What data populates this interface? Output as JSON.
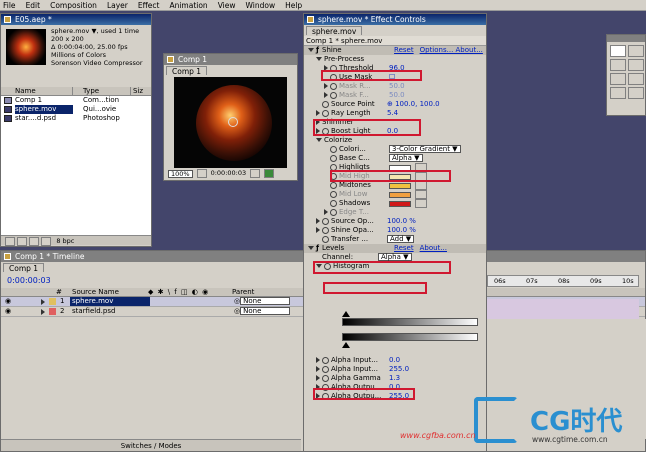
{
  "menu": [
    "File",
    "Edit",
    "Composition",
    "Layer",
    "Effect",
    "Animation",
    "View",
    "Window",
    "Help"
  ],
  "project": {
    "title": "E05.aep *",
    "info_lines": [
      "sphere.mov ▼, used 1 time",
      "200 x 200",
      "Δ 0:00:04:00, 25.00 fps",
      "Millions of Colors",
      "Sorenson Video Compressor"
    ],
    "col_name": "Name",
    "col_type": "Type",
    "col_size": "Siz",
    "items": [
      {
        "name": "Comp 1",
        "type": "Com...tion",
        "selected": false
      },
      {
        "name": "sphere.mov",
        "type": "Qui...ovie",
        "selected": true
      },
      {
        "name": "star....d.psd",
        "type": "Photoshop",
        "selected": false
      }
    ],
    "bpc": "8 bpc"
  },
  "comp": {
    "title": "Comp 1",
    "tab": "Comp 1",
    "zoom": "100%",
    "time": "0:00:00:03"
  },
  "effects": {
    "title": "sphere.mov * Effect Controls",
    "tab": "sphere.mov",
    "breadcrumb": "Comp 1 * sphere.mov",
    "rows": [
      {
        "indent": 0,
        "twirl": "down",
        "fx": true,
        "label": "Shine",
        "value": "Reset",
        "extra": "Options...   About..."
      },
      {
        "indent": 1,
        "twirl": "down",
        "label": "Pre-Process",
        "value": "",
        "extra": ""
      },
      {
        "indent": 2,
        "twirl": "right",
        "stop": true,
        "label": "Threshold",
        "value": "96.0",
        "extra": ""
      },
      {
        "indent": 2,
        "twirl": "none",
        "stop": true,
        "label": "Use Mask",
        "value": "☐",
        "extra": ""
      },
      {
        "indent": 2,
        "twirl": "right",
        "stop": true,
        "label": "Mask R...",
        "value": "50.0",
        "extra": "",
        "dim": true
      },
      {
        "indent": 2,
        "twirl": "right",
        "stop": true,
        "label": "Mask F...",
        "value": "50.0",
        "extra": "",
        "dim": true
      },
      {
        "indent": 1,
        "twirl": "none",
        "stop": true,
        "label": "Source Point",
        "value": "⊕  100.0, 100.0",
        "extra": ""
      },
      {
        "indent": 1,
        "twirl": "right",
        "stop": true,
        "label": "Ray Length",
        "value": "5.4",
        "extra": ""
      },
      {
        "indent": 1,
        "twirl": "right",
        "label": "Shimmer",
        "value": "",
        "extra": ""
      },
      {
        "indent": 1,
        "twirl": "right",
        "stop": true,
        "label": "Boost Light",
        "value": "0.0",
        "extra": ""
      },
      {
        "indent": 1,
        "twirl": "down",
        "label": "Colorize",
        "value": "",
        "extra": ""
      },
      {
        "indent": 2,
        "twirl": "none",
        "stop": true,
        "label": "Colori...",
        "value": "3-Color Gradient ▼",
        "extra": ""
      },
      {
        "indent": 2,
        "twirl": "none",
        "stop": true,
        "label": "Base C...",
        "value": "Alpha           ▼",
        "extra": ""
      },
      {
        "indent": 2,
        "twirl": "none",
        "stop": true,
        "label": "Highligts",
        "value": "",
        "swatch": "#ffffff"
      },
      {
        "indent": 2,
        "twirl": "none",
        "stop": true,
        "label": "Mid High",
        "value": "",
        "swatch": "#f4e8b0",
        "dim": true
      },
      {
        "indent": 2,
        "twirl": "none",
        "stop": true,
        "label": "Midtones",
        "value": "",
        "swatch": "#f0c040"
      },
      {
        "indent": 2,
        "twirl": "none",
        "stop": true,
        "label": "Mid Low",
        "value": "",
        "swatch": "#f0a040",
        "dim": true
      },
      {
        "indent": 2,
        "twirl": "none",
        "stop": true,
        "label": "Shadows",
        "value": "",
        "swatch": "#d01818"
      },
      {
        "indent": 2,
        "twirl": "right",
        "stop": true,
        "label": "Edge T...",
        "value": "",
        "extra": "",
        "dim": true
      },
      {
        "indent": 1,
        "twirl": "right",
        "stop": true,
        "label": "Source Op...",
        "value": "100.0 %",
        "extra": ""
      },
      {
        "indent": 1,
        "twirl": "right",
        "stop": true,
        "label": "Shine Opa...",
        "value": "100.0 %",
        "extra": ""
      },
      {
        "indent": 1,
        "twirl": "none",
        "stop": true,
        "label": "Transfer ...",
        "value": "Add             ▼",
        "extra": ""
      },
      {
        "indent": 0,
        "twirl": "down",
        "fx": true,
        "label": "Levels",
        "value": "Reset",
        "extra": "About..."
      },
      {
        "indent": 1,
        "twirl": "none",
        "label": "Channel:",
        "value": "Alpha ▼",
        "extra": ""
      },
      {
        "indent": 1,
        "twirl": "down",
        "stop": true,
        "label": "Histogram",
        "value": "",
        "extra": ""
      }
    ],
    "levels_rows": [
      {
        "label": "Alpha Input...",
        "value": "0.0"
      },
      {
        "label": "Alpha Input...",
        "value": "255.0"
      },
      {
        "label": "Alpha Gamma",
        "value": "1.3"
      },
      {
        "label": "Alpha Outpu...",
        "value": "0.0"
      },
      {
        "label": "Alpha Outpu...",
        "value": "255.0"
      }
    ]
  },
  "timeline": {
    "title": "Comp 1 * Timeline",
    "tab": "Comp 1",
    "time": "0:00:00:03",
    "col_num": "#",
    "col_source": "Source Name",
    "col_parent": "Parent",
    "layers": [
      {
        "num": "1",
        "name": "sphere.mov",
        "parent": "None",
        "selected": true
      },
      {
        "num": "2",
        "name": "starfield.psd",
        "parent": "None",
        "selected": false
      }
    ],
    "footer": "Switches / Modes",
    "ruler": [
      "06s",
      "07s",
      "08s",
      "09s",
      "10s"
    ]
  },
  "tools": {
    "title": ""
  },
  "watermark": {
    "url_left": "www.cgfba.com.cn",
    "brand": "CG时代",
    "url_right": "www.cgtime.com.cn"
  }
}
